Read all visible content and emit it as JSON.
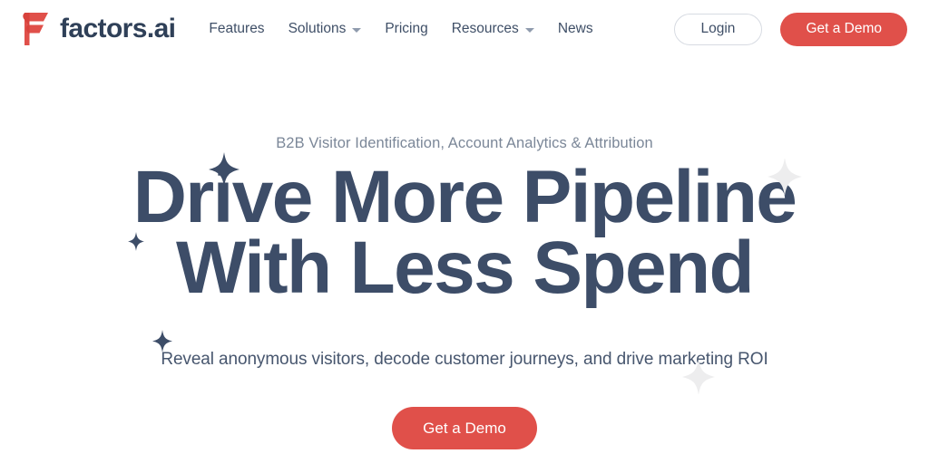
{
  "brand": {
    "name": "factors.ai",
    "logo_icon": "factors-f-logo-icon",
    "logo_color": "#e0504a",
    "text_color": "#2f4058"
  },
  "nav": {
    "items": [
      {
        "label": "Features",
        "has_dropdown": false
      },
      {
        "label": "Solutions",
        "has_dropdown": true
      },
      {
        "label": "Pricing",
        "has_dropdown": false
      },
      {
        "label": "Resources",
        "has_dropdown": true
      },
      {
        "label": "News",
        "has_dropdown": false
      }
    ],
    "login_label": "Login",
    "demo_label": "Get a Demo",
    "chevron_icon": "chevron-down-icon"
  },
  "hero": {
    "eyebrow": "B2B Visitor Identification, Account Analytics & Attribution",
    "headline_line1": "Drive More Pipeline",
    "headline_line2": "With Less Spend",
    "subheadline": "Reveal anonymous visitors, decode customer journeys, and drive marketing ROI",
    "cta_label": "Get a Demo",
    "heading_color": "#3d4d68",
    "accent_color": "#e0504a"
  },
  "decor": {
    "sparkle_icon": "four-point-sparkle-icon",
    "dark_color": "#3d4d68",
    "light_color": "#ededee"
  }
}
